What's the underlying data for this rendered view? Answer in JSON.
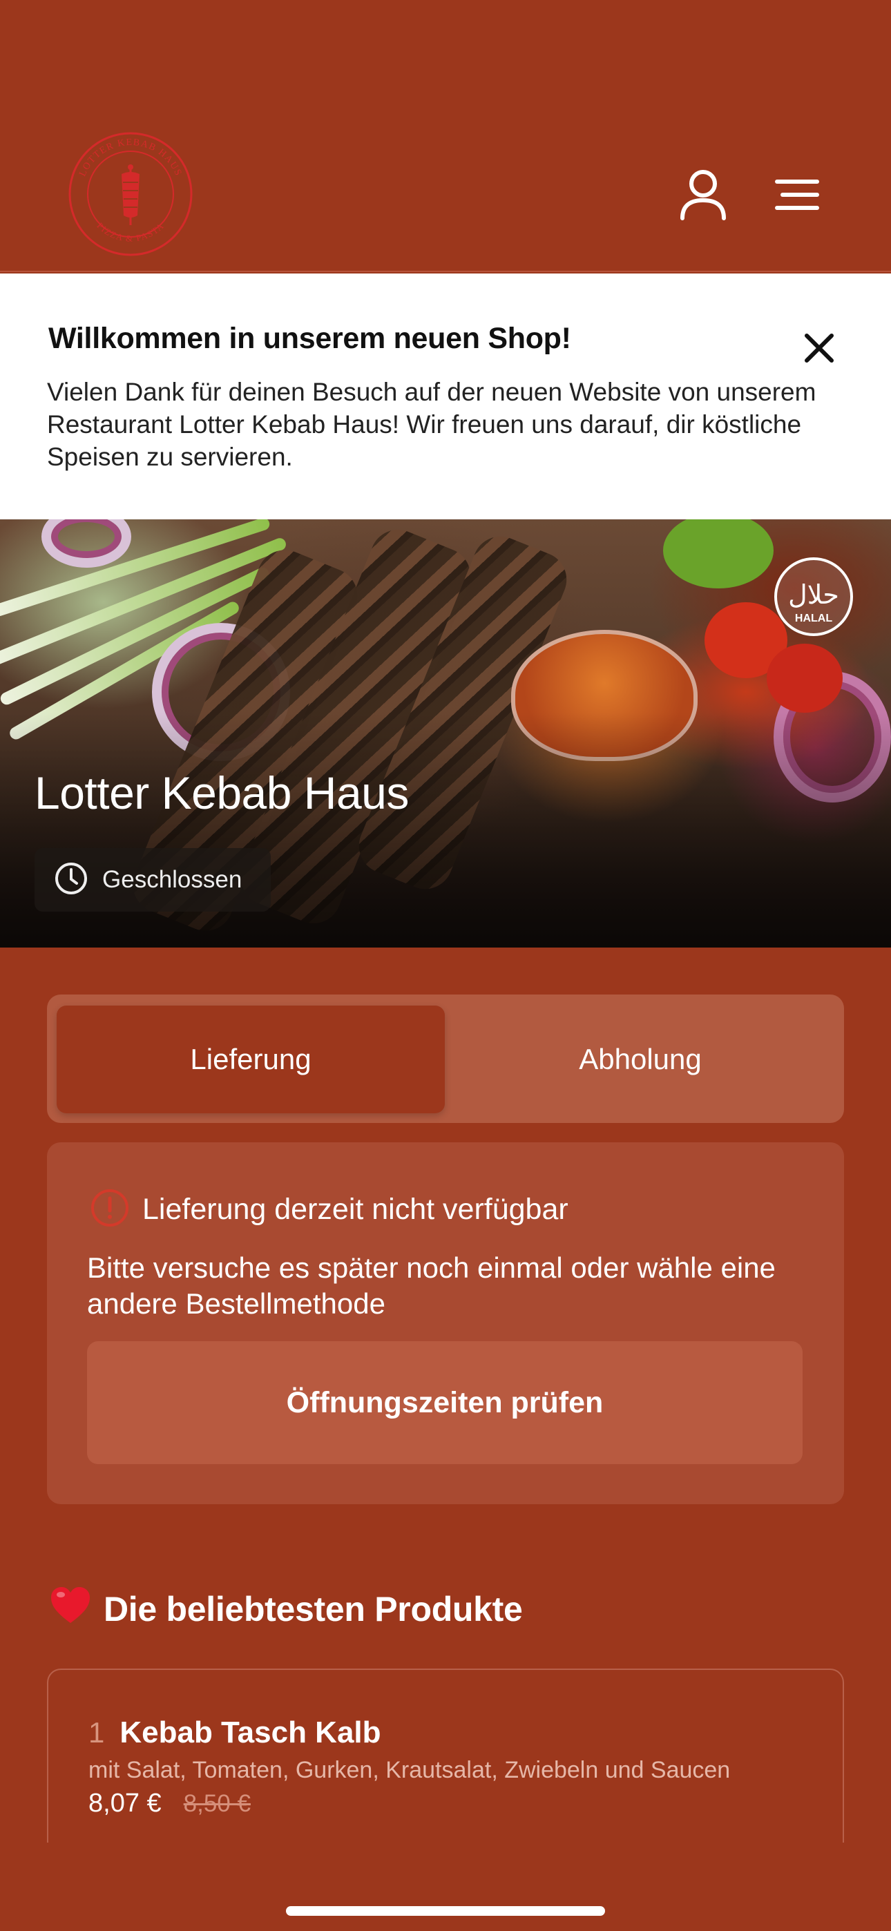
{
  "header": {
    "logo_ring_top": "LOTTER KEBAB HAUS",
    "logo_ring_bottom": "PIZZA & PASTA",
    "user_icon": "user-icon",
    "menu_icon": "hamburger-menu-icon"
  },
  "banner": {
    "title": "Willkommen in unserem neuen Shop!",
    "text": "Vielen Dank für deinen Besuch auf der neuen Website von unserem Restaurant Lotter Kebab Haus! Wir freuen uns darauf, dir köstliche Speisen zu servieren.",
    "close_icon": "close-icon"
  },
  "hero": {
    "title": "Lotter Kebab Haus",
    "status": "Geschlossen",
    "status_icon": "clock-icon",
    "badge_arabic": "حلال",
    "badge_label": "HALAL"
  },
  "order_type": {
    "options": [
      "Lieferung",
      "Abholung"
    ],
    "selected": "Lieferung"
  },
  "notice": {
    "title": "Lieferung derzeit nicht verfügbar",
    "text": "Bitte versuche es später noch einmal oder wähle eine andere Bestellmethode",
    "button": "Öffnungszeiten prüfen",
    "icon": "warning-icon"
  },
  "popular": {
    "title": "Die beliebtesten Produkte",
    "emoji": "❤️",
    "products": [
      {
        "rank": "1",
        "name": "Kebab Tasch Kalb",
        "description": "mit Salat, Tomaten, Gurken, Krautsalat, Zwiebeln und Saucen",
        "price": "8,07 €",
        "old_price": "8,50 €"
      }
    ]
  },
  "colors": {
    "brand": "#9c371c",
    "card": "#a94a31",
    "toggle_bg": "#b25a40",
    "banner_bg": "#ffffff",
    "logo_red": "#d42a2a"
  }
}
